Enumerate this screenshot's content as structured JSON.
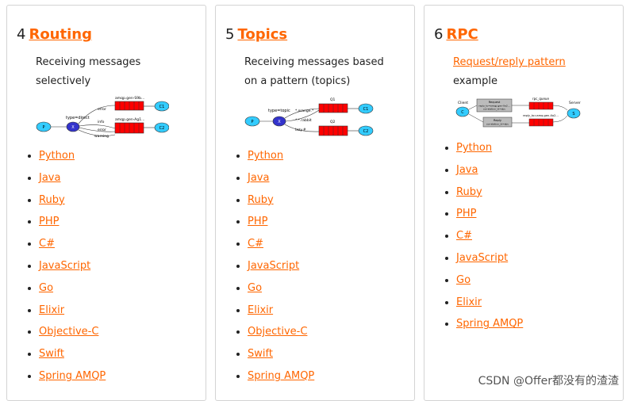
{
  "cards": [
    {
      "number": "4",
      "title": "Routing",
      "desc_line1": "Receiving messages",
      "desc_line2": "selectively",
      "diagram": {
        "exchange_label": "type=direct",
        "queue1_name": "amqp.gen-S9b...",
        "queue2_name": "amqp.gen-Ag1...",
        "bind_error": "error",
        "bind_info": "info",
        "bind_error2": "error",
        "bind_warning": "warning",
        "producer": "P",
        "exchange": "X",
        "consumer1": "C1",
        "consumer2": "C2"
      },
      "languages": [
        "Python",
        "Java",
        "Ruby",
        "PHP",
        "C#",
        "JavaScript",
        "Go",
        "Elixir",
        "Objective-C",
        "Swift",
        "Spring AMQP"
      ]
    },
    {
      "number": "5",
      "title": "Topics",
      "desc_line1": "Receiving messages based",
      "desc_line2": "on a pattern (topics)",
      "diagram": {
        "exchange_label": "type=topic",
        "queue1_name": "Q1",
        "queue2_name": "Q2",
        "bind1": "*.orange.*",
        "bind2": "*.*.rabbit",
        "bind3": "lazy.#",
        "producer": "P",
        "exchange": "X",
        "consumer1": "C1",
        "consumer2": "C2"
      },
      "languages": [
        "Python",
        "Java",
        "Ruby",
        "PHP",
        "C#",
        "JavaScript",
        "Go",
        "Elixir",
        "Objective-C",
        "Swift",
        "Spring AMQP"
      ]
    },
    {
      "number": "6",
      "title": "RPC",
      "desc_link": "Request/reply pattern",
      "desc_line2": "example",
      "diagram": {
        "client": "Client",
        "server": "Server",
        "rpc_queue": "rpc_queue",
        "reply_queue": "reply_to=amq.gen-Xa2...",
        "request_box_l1": "Request",
        "request_box_l2": "reply_to=amqp.gen-Xa2...",
        "request_box_l3": "correlation_id=abc",
        "reply_box_l1": "Reply",
        "reply_box_l2": "correlation_id=abc",
        "c": "C",
        "s": "S"
      },
      "languages": [
        "Python",
        "Java",
        "Ruby",
        "PHP",
        "C#",
        "JavaScript",
        "Go",
        "Elixir",
        "Spring AMQP"
      ]
    }
  ],
  "watermark": "CSDN @Offer都没有的渣渣",
  "colors": {
    "link": "#ff6600",
    "queue": "#ff0000",
    "node": "#33ccff",
    "exchange": "#3333cc"
  }
}
